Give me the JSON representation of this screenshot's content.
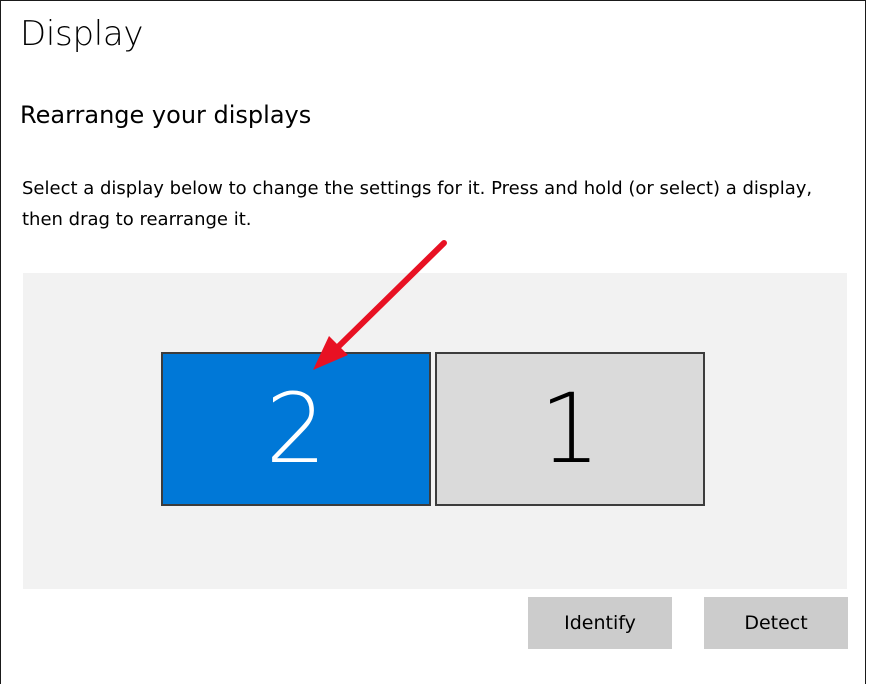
{
  "page": {
    "title": "Display"
  },
  "arrangement": {
    "heading": "Rearrange your displays",
    "description": "Select a display below to change the settings for it. Press and hold (or select) a display, then drag to rearrange it.",
    "monitors": [
      {
        "number": "2",
        "selected": true
      },
      {
        "number": "1",
        "selected": false
      }
    ]
  },
  "buttons": {
    "identify_label": "Identify",
    "detect_label": "Detect"
  },
  "colors": {
    "selected_monitor": "#0078d7",
    "unselected_monitor": "#dadada",
    "arrangement_background": "#f2f2f2",
    "button_background": "#cccccc",
    "annotation_arrow": "#e81123"
  }
}
